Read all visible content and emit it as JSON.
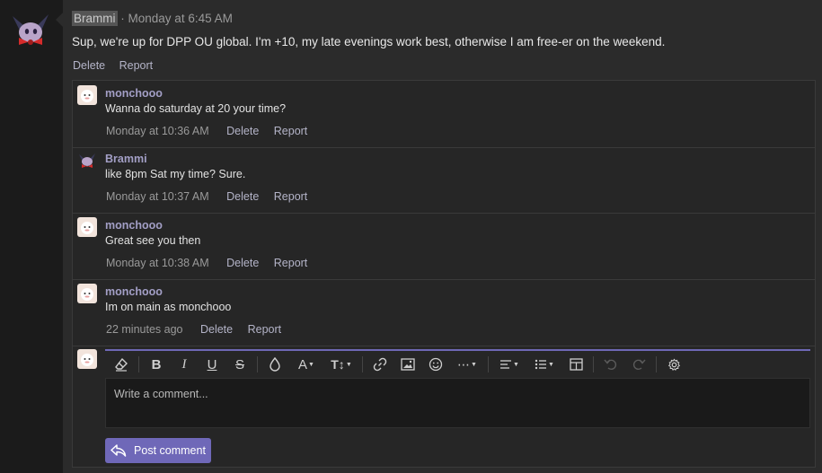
{
  "post": {
    "author": "Brammi",
    "separator": "·",
    "timestamp": "Monday at 6:45 AM",
    "body": "Sup, we're up for DPP OU global. I'm +10, my late evenings work best, otherwise I am free-er on the weekend.",
    "actions": {
      "delete": "Delete",
      "report": "Report"
    }
  },
  "comments": [
    {
      "author": "monchooo",
      "text": "Wanna do saturday at 20 your time?",
      "time": "Monday at 10:36 AM",
      "delete": "Delete",
      "report": "Report",
      "avatar": "monchooo-avatar"
    },
    {
      "author": "Brammi",
      "text": "like 8pm Sat my time? Sure.",
      "time": "Monday at 10:37 AM",
      "delete": "Delete",
      "report": "Report",
      "avatar": "brammi-avatar"
    },
    {
      "author": "monchooo",
      "text": "Great see you then",
      "time": "Monday at 10:38 AM",
      "delete": "Delete",
      "report": "Report",
      "avatar": "monchooo-avatar"
    },
    {
      "author": "monchooo",
      "text": "Im on main as monchooo",
      "time": "22 minutes ago",
      "delete": "Delete",
      "report": "Report",
      "avatar": "monchooo-avatar"
    }
  ],
  "composer": {
    "placeholder": "Write a comment...",
    "submit_label": "Post comment"
  },
  "colors": {
    "accent": "#6f68b8",
    "author_name": "#a39fc6",
    "link": "#b4b4c8"
  }
}
